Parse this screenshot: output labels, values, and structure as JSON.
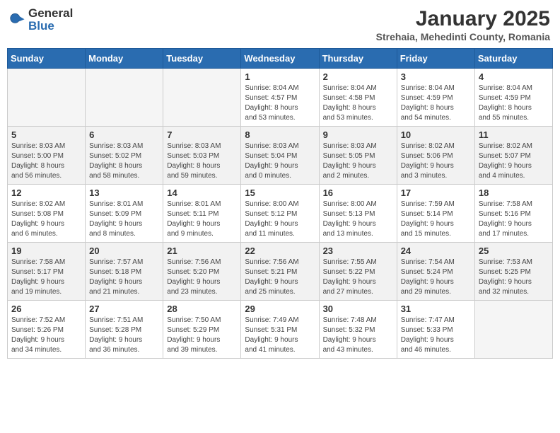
{
  "header": {
    "logo_general": "General",
    "logo_blue": "Blue",
    "title": "January 2025",
    "subtitle": "Strehaia, Mehedinti County, Romania"
  },
  "weekdays": [
    "Sunday",
    "Monday",
    "Tuesday",
    "Wednesday",
    "Thursday",
    "Friday",
    "Saturday"
  ],
  "weeks": [
    [
      {
        "day": "",
        "info": ""
      },
      {
        "day": "",
        "info": ""
      },
      {
        "day": "",
        "info": ""
      },
      {
        "day": "1",
        "info": "Sunrise: 8:04 AM\nSunset: 4:57 PM\nDaylight: 8 hours\nand 53 minutes."
      },
      {
        "day": "2",
        "info": "Sunrise: 8:04 AM\nSunset: 4:58 PM\nDaylight: 8 hours\nand 53 minutes."
      },
      {
        "day": "3",
        "info": "Sunrise: 8:04 AM\nSunset: 4:59 PM\nDaylight: 8 hours\nand 54 minutes."
      },
      {
        "day": "4",
        "info": "Sunrise: 8:04 AM\nSunset: 4:59 PM\nDaylight: 8 hours\nand 55 minutes."
      }
    ],
    [
      {
        "day": "5",
        "info": "Sunrise: 8:03 AM\nSunset: 5:00 PM\nDaylight: 8 hours\nand 56 minutes."
      },
      {
        "day": "6",
        "info": "Sunrise: 8:03 AM\nSunset: 5:02 PM\nDaylight: 8 hours\nand 58 minutes."
      },
      {
        "day": "7",
        "info": "Sunrise: 8:03 AM\nSunset: 5:03 PM\nDaylight: 8 hours\nand 59 minutes."
      },
      {
        "day": "8",
        "info": "Sunrise: 8:03 AM\nSunset: 5:04 PM\nDaylight: 9 hours\nand 0 minutes."
      },
      {
        "day": "9",
        "info": "Sunrise: 8:03 AM\nSunset: 5:05 PM\nDaylight: 9 hours\nand 2 minutes."
      },
      {
        "day": "10",
        "info": "Sunrise: 8:02 AM\nSunset: 5:06 PM\nDaylight: 9 hours\nand 3 minutes."
      },
      {
        "day": "11",
        "info": "Sunrise: 8:02 AM\nSunset: 5:07 PM\nDaylight: 9 hours\nand 4 minutes."
      }
    ],
    [
      {
        "day": "12",
        "info": "Sunrise: 8:02 AM\nSunset: 5:08 PM\nDaylight: 9 hours\nand 6 minutes."
      },
      {
        "day": "13",
        "info": "Sunrise: 8:01 AM\nSunset: 5:09 PM\nDaylight: 9 hours\nand 8 minutes."
      },
      {
        "day": "14",
        "info": "Sunrise: 8:01 AM\nSunset: 5:11 PM\nDaylight: 9 hours\nand 9 minutes."
      },
      {
        "day": "15",
        "info": "Sunrise: 8:00 AM\nSunset: 5:12 PM\nDaylight: 9 hours\nand 11 minutes."
      },
      {
        "day": "16",
        "info": "Sunrise: 8:00 AM\nSunset: 5:13 PM\nDaylight: 9 hours\nand 13 minutes."
      },
      {
        "day": "17",
        "info": "Sunrise: 7:59 AM\nSunset: 5:14 PM\nDaylight: 9 hours\nand 15 minutes."
      },
      {
        "day": "18",
        "info": "Sunrise: 7:58 AM\nSunset: 5:16 PM\nDaylight: 9 hours\nand 17 minutes."
      }
    ],
    [
      {
        "day": "19",
        "info": "Sunrise: 7:58 AM\nSunset: 5:17 PM\nDaylight: 9 hours\nand 19 minutes."
      },
      {
        "day": "20",
        "info": "Sunrise: 7:57 AM\nSunset: 5:18 PM\nDaylight: 9 hours\nand 21 minutes."
      },
      {
        "day": "21",
        "info": "Sunrise: 7:56 AM\nSunset: 5:20 PM\nDaylight: 9 hours\nand 23 minutes."
      },
      {
        "day": "22",
        "info": "Sunrise: 7:56 AM\nSunset: 5:21 PM\nDaylight: 9 hours\nand 25 minutes."
      },
      {
        "day": "23",
        "info": "Sunrise: 7:55 AM\nSunset: 5:22 PM\nDaylight: 9 hours\nand 27 minutes."
      },
      {
        "day": "24",
        "info": "Sunrise: 7:54 AM\nSunset: 5:24 PM\nDaylight: 9 hours\nand 29 minutes."
      },
      {
        "day": "25",
        "info": "Sunrise: 7:53 AM\nSunset: 5:25 PM\nDaylight: 9 hours\nand 32 minutes."
      }
    ],
    [
      {
        "day": "26",
        "info": "Sunrise: 7:52 AM\nSunset: 5:26 PM\nDaylight: 9 hours\nand 34 minutes."
      },
      {
        "day": "27",
        "info": "Sunrise: 7:51 AM\nSunset: 5:28 PM\nDaylight: 9 hours\nand 36 minutes."
      },
      {
        "day": "28",
        "info": "Sunrise: 7:50 AM\nSunset: 5:29 PM\nDaylight: 9 hours\nand 39 minutes."
      },
      {
        "day": "29",
        "info": "Sunrise: 7:49 AM\nSunset: 5:31 PM\nDaylight: 9 hours\nand 41 minutes."
      },
      {
        "day": "30",
        "info": "Sunrise: 7:48 AM\nSunset: 5:32 PM\nDaylight: 9 hours\nand 43 minutes."
      },
      {
        "day": "31",
        "info": "Sunrise: 7:47 AM\nSunset: 5:33 PM\nDaylight: 9 hours\nand 46 minutes."
      },
      {
        "day": "",
        "info": ""
      }
    ]
  ]
}
